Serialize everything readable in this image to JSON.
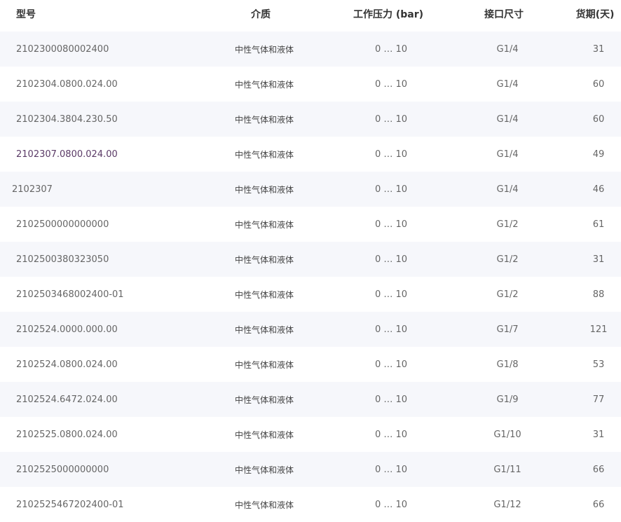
{
  "table": {
    "headers": {
      "model": "型号",
      "medium": "介质",
      "pressure": "工作压力 (bar)",
      "port": "接口尺寸",
      "lead": "货期(天)"
    },
    "rows": [
      {
        "model": "2102300080002400",
        "medium": "中性气体和液体",
        "pressure": "0 … 10",
        "port": "G1/4",
        "lead": "31"
      },
      {
        "model": "2102304.0800.024.00",
        "medium": "中性气体和液体",
        "pressure": "0 … 10",
        "port": "G1/4",
        "lead": "60"
      },
      {
        "model": "2102304.3804.230.50",
        "medium": "中性气体和液体",
        "pressure": "0 … 10",
        "port": "G1/4",
        "lead": "60"
      },
      {
        "model": "2102307.0800.024.00",
        "medium": "中性气体和液体",
        "pressure": "0 … 10",
        "port": "G1/4",
        "lead": "49"
      },
      {
        "model": "2102307",
        "medium": "中性气体和液体",
        "pressure": "0 … 10",
        "port": "G1/4",
        "lead": "46"
      },
      {
        "model": "2102500000000000",
        "medium": "中性气体和液体",
        "pressure": "0 … 10",
        "port": "G1/2",
        "lead": "61"
      },
      {
        "model": "2102500380323050",
        "medium": "中性气体和液体",
        "pressure": "0 … 10",
        "port": "G1/2",
        "lead": "31"
      },
      {
        "model": "2102503468002400-01",
        "medium": "中性气体和液体",
        "pressure": "0 … 10",
        "port": "G1/2",
        "lead": "88"
      },
      {
        "model": "2102524.0000.000.00",
        "medium": "中性气体和液体",
        "pressure": "0 … 10",
        "port": "G1/7",
        "lead": "121"
      },
      {
        "model": "2102524.0800.024.00",
        "medium": "中性气体和液体",
        "pressure": "0 … 10",
        "port": "G1/8",
        "lead": "53"
      },
      {
        "model": "2102524.6472.024.00",
        "medium": "中性气体和液体",
        "pressure": "0 … 10",
        "port": "G1/9",
        "lead": "77"
      },
      {
        "model": "2102525.0800.024.00",
        "medium": "中性气体和液体",
        "pressure": "0 … 10",
        "port": "G1/10",
        "lead": "31"
      },
      {
        "model": "2102525000000000",
        "medium": "中性气体和液体",
        "pressure": "0 … 10",
        "port": "G1/11",
        "lead": "66"
      },
      {
        "model": "2102525467202400-01",
        "medium": "中性气体和液体",
        "pressure": "0 … 10",
        "port": "G1/12",
        "lead": "66"
      }
    ]
  },
  "colors": {
    "stripe": "#f6f7fb",
    "header_text": "#333333",
    "cell_text": "#666666",
    "highlight_text": "#5a3a66"
  }
}
